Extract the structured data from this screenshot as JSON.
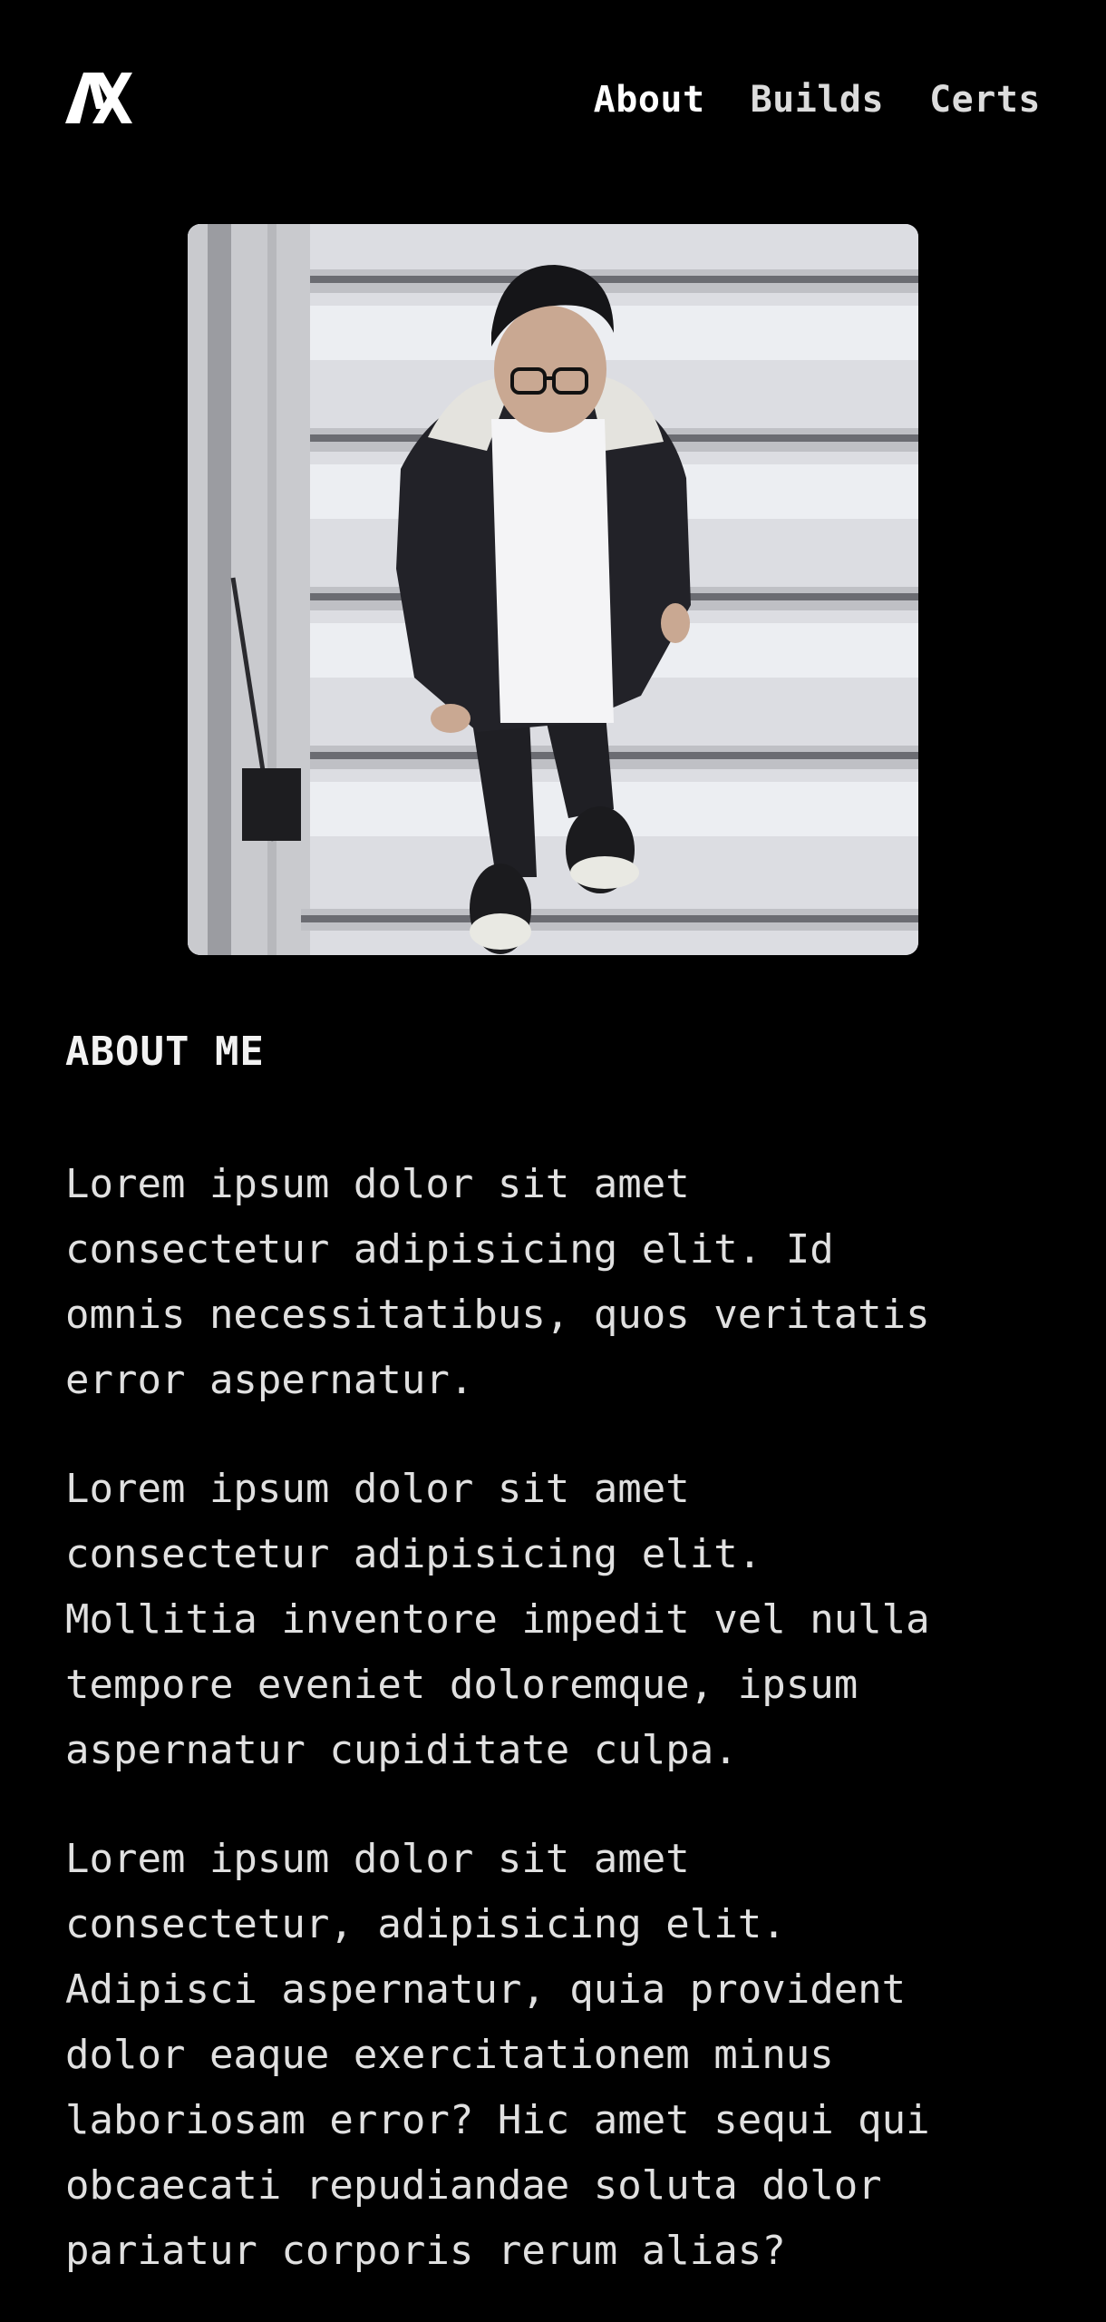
{
  "header": {
    "logo_icon": "ax-monogram-icon",
    "nav": [
      {
        "label": "About",
        "active": true
      },
      {
        "label": "Builds",
        "active": false
      },
      {
        "label": "Certs",
        "active": false
      }
    ]
  },
  "profile": {
    "photo_icon": "profile-photo"
  },
  "about": {
    "title": "ABOUT ME",
    "paragraphs": [
      "Lorem ipsum dolor sit amet\nconsectetur adipisicing elit. Id\nomnis necessitatibus, quos veritatis\nerror aspernatur.",
      "Lorem ipsum dolor sit amet\nconsectetur adipisicing elit.\nMollitia inventore impedit vel nulla\ntempore eveniet doloremque, ipsum\naspernatur cupiditate culpa.",
      "Lorem ipsum dolor sit amet\nconsectetur, adipisicing elit.\nAdipisci aspernatur, quia provident\ndolor eaque exercitationem minus\nlaboriosam error? Hic amet sequi qui\nobcaecati repudiandae soluta dolor\npariatur corporis rerum alias?"
    ]
  },
  "colors": {
    "background": "#000000",
    "text": "#e0e0e0",
    "heading": "#f2f2f2"
  }
}
